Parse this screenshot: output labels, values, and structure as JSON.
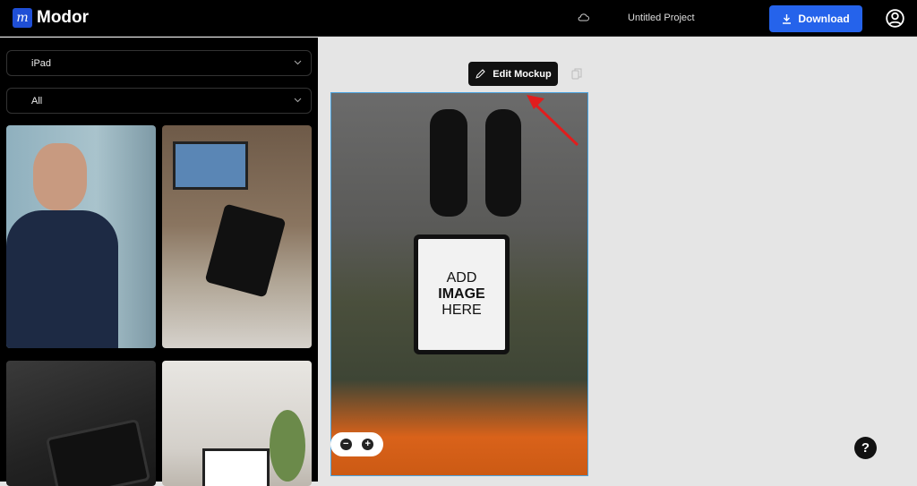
{
  "header": {
    "logo_mark": "m",
    "logo_text": "Modor",
    "project_title": "Untitled Project",
    "download_label": "Download"
  },
  "sidebar": {
    "device_select": "iPad",
    "category_select": "All",
    "thumbnails": [
      "Man in suit holding iPad",
      "Person on couch holding iPad near TV",
      "iPad on dark desk",
      "iPad on living room table"
    ]
  },
  "canvas": {
    "edit_label": "Edit Mockup",
    "placeholder_lines": [
      "ADD",
      "IMAGE",
      "HERE"
    ],
    "zoom_out": "−",
    "zoom_in": "+"
  },
  "help_label": "?",
  "colors": {
    "accent": "#2563eb",
    "annotation": "#e11d1d"
  }
}
